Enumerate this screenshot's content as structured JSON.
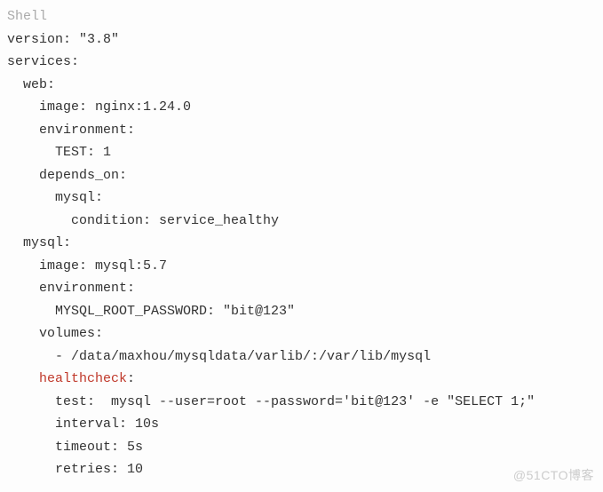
{
  "lang_label": "Shell",
  "lines": {
    "l1": "version: \"3.8\"",
    "l2": "services:",
    "l3": "  web:",
    "l4": "    image: nginx:1.24.0",
    "l5": "    environment:",
    "l6": "      TEST: 1",
    "l7": "    depends_on:",
    "l8": "      mysql:",
    "l9": "        condition: service_healthy",
    "l10": "  mysql:",
    "l11": "    image: mysql:5.7",
    "l12": "    environment:",
    "l13": "      MYSQL_ROOT_PASSWORD: \"bit@123\"",
    "l14": "    volumes:",
    "l15": "      - /data/maxhou/mysqldata/varlib/:/var/lib/mysql",
    "l16a": "    ",
    "l16b": "healthcheck",
    "l16c": ":",
    "l17": "      test:  mysql --user=root --password='bit@123' -e \"SELECT 1;\"",
    "l18": "      interval: 10s",
    "l19": "      timeout: 5s",
    "l20": "      retries: 10"
  },
  "watermark": "@51CTO博客"
}
